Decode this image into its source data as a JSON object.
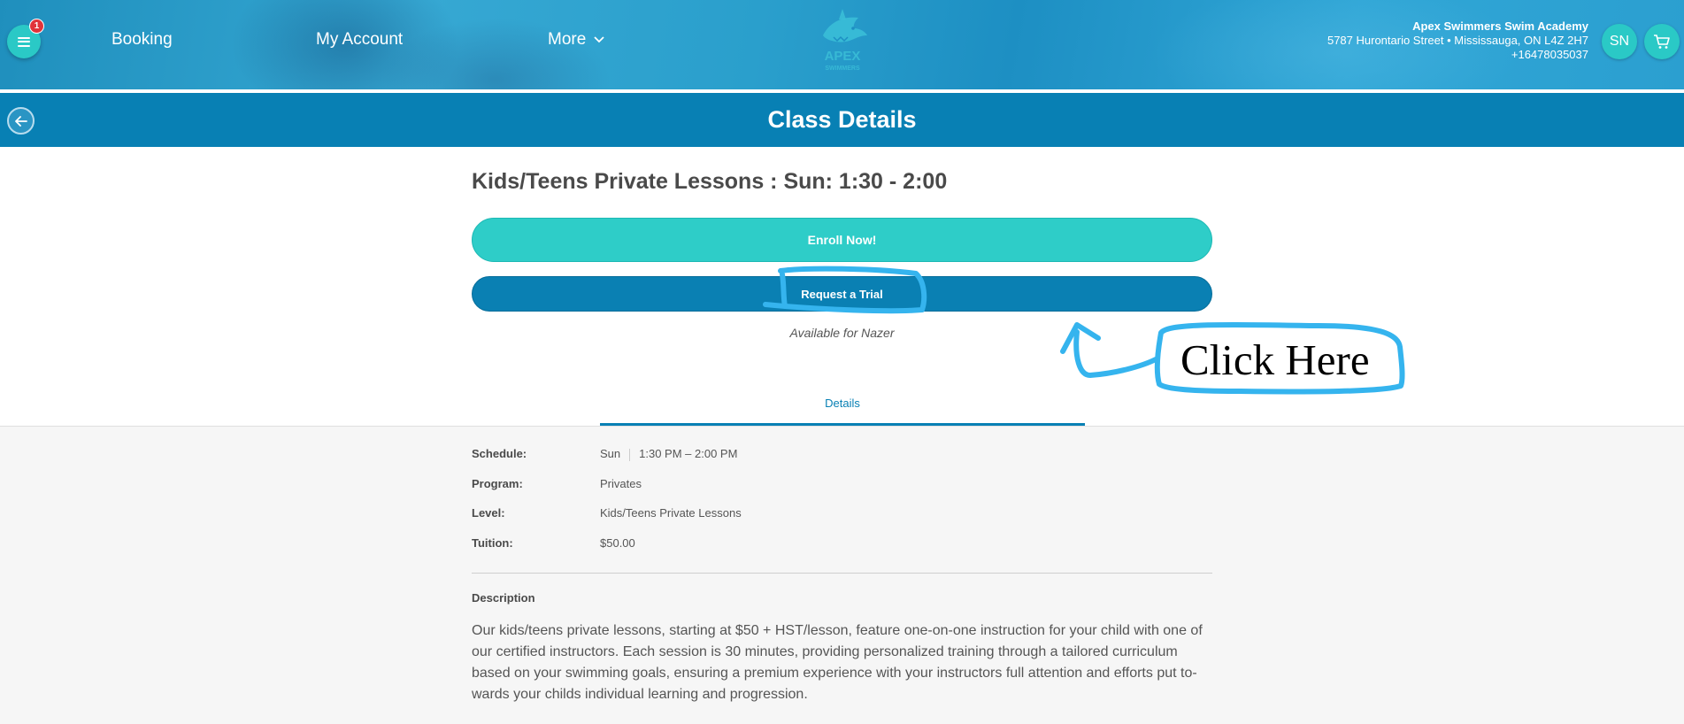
{
  "header": {
    "menu_badge": "1",
    "nav": {
      "booking": "Booking",
      "my_account": "My Account",
      "more": "More"
    },
    "logo_text": "APEX",
    "logo_subtext": "SWIMMERS",
    "business": {
      "name": "Apex Swimmers Swim Academy",
      "address": "5787 Hurontario Street • Mississauga, ON L4Z 2H7",
      "phone": "+16478035037"
    },
    "avatar_initials": "SN"
  },
  "title_bar": {
    "title": "Class Details"
  },
  "class": {
    "title": "Kids/Teens Private Lessons : Sun: 1:30 - 2:00",
    "enroll_label": "Enroll Now!",
    "trial_label": "Request a Trial",
    "availability": "Available for Nazer"
  },
  "tabs": {
    "details": "Details"
  },
  "details": {
    "schedule_label": "Schedule:",
    "schedule_day": "Sun",
    "schedule_time": "1:30 PM – 2:00 PM",
    "program_label": "Program:",
    "program_value": "Privates",
    "level_label": "Level:",
    "level_value": "Kids/Teens Private Lessons",
    "tuition_label": "Tuition:",
    "tuition_value": "$50.00"
  },
  "description": {
    "title": "Description",
    "text": "Our kids/teens private lessons, starting at $50 + HST/lesson, feature one-on-one instruction for your child with one of our certified instructors. Each session is 30 minutes, providing personalized training through a tailored curriculum based on your swimming goals, ensuring a premium experience with your instructors full attention and efforts put to-wards your childs individual learning and progression."
  },
  "annotation": {
    "text": "Click Here"
  },
  "colors": {
    "header_blue": "#2a9fcc",
    "title_bar_blue": "#0880b4",
    "enroll_teal": "#2ecdc8",
    "trial_blue": "#0a80b3",
    "annotation_blue": "#35b4ee",
    "badge_red": "#e0333a"
  },
  "icons": [
    "menu-icon",
    "chevron-down-icon",
    "shark-logo-icon",
    "back-arrow-icon",
    "cart-icon"
  ]
}
